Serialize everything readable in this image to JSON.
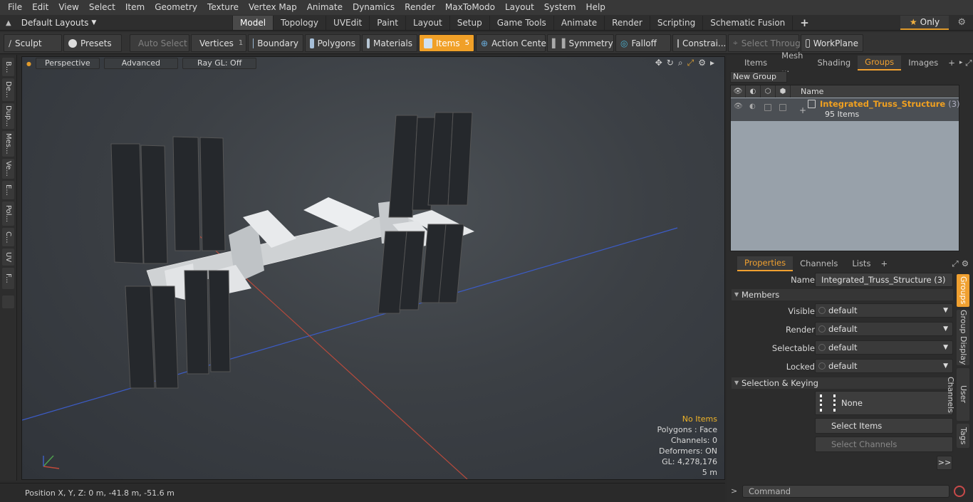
{
  "menubar": [
    "File",
    "Edit",
    "View",
    "Select",
    "Item",
    "Geometry",
    "Texture",
    "Vertex Map",
    "Animate",
    "Dynamics",
    "Render",
    "MaxToModo",
    "Layout",
    "System",
    "Help"
  ],
  "layout_selector": "Default Layouts",
  "mode_tabs": [
    "Model",
    "Topology",
    "UVEdit",
    "Paint",
    "Layout",
    "Setup",
    "Game Tools",
    "Animate",
    "Render",
    "Scripting",
    "Schematic Fusion"
  ],
  "only_label": "Only",
  "toolbar": {
    "sculpt": "Sculpt",
    "presets": "Presets",
    "auto_select": "Auto Select",
    "vertices": "Vertices",
    "vertices_count": "1",
    "boundary": "Boundary",
    "polygons": "Polygons",
    "materials": "Materials",
    "items": "Items",
    "items_count": "5",
    "action_center": "Action Center",
    "symmetry": "Symmetry",
    "falloff": "Falloff",
    "constraints": "Constrai...",
    "select_through": "Select Through",
    "workplane": "WorkPlane"
  },
  "left_tabs": [
    "B...",
    "De...",
    "Dup...",
    "Mes...",
    "Ve...",
    "E...",
    "Pol...",
    "C...",
    "UV",
    "F..."
  ],
  "viewport": {
    "view": "Perspective",
    "shading": "Advanced",
    "raygl": "Ray GL: Off",
    "stats": {
      "selection": "No Items",
      "polygons": "Polygons : Face",
      "channels": "Channels: 0",
      "deformers": "Deformers: ON",
      "gl": "GL: 4,278,176",
      "scale": "5 m"
    }
  },
  "status": "Position X, Y, Z:   0 m, -41.8 m, -51.6 m",
  "right_tabs": [
    "Items",
    "Mesh ...",
    "Shading",
    "Groups",
    "Images"
  ],
  "groups": {
    "new_group": "New Group",
    "col_name": "Name",
    "group_name": "Integrated_Truss_Structure",
    "group_count": "(3)",
    "group_items": "95 Items"
  },
  "prop_tabs": [
    "Properties",
    "Channels",
    "Lists"
  ],
  "properties": {
    "name_label": "Name",
    "name_value": "Integrated_Truss_Structure (3)",
    "members_section": "Members",
    "visible_label": "Visible",
    "render_label": "Render",
    "selectable_label": "Selectable",
    "locked_label": "Locked",
    "default_value": "default",
    "selkey_section": "Selection & Keying",
    "none_label": "None",
    "select_items": "Select Items",
    "select_channels": "Select Channels",
    "more": ">>"
  },
  "side_tabs": [
    "Groups",
    "Group Display",
    "User Channels",
    "Tags"
  ],
  "command_placeholder": "Command"
}
